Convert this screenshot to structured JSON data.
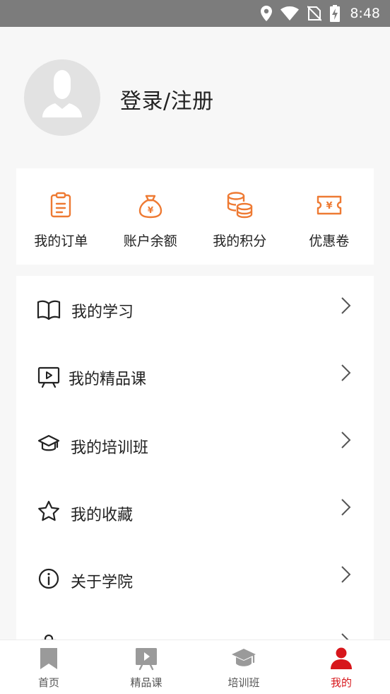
{
  "status_bar": {
    "time": "8:48",
    "icons": [
      "location-icon",
      "wifi-icon",
      "no-sim-icon",
      "battery-charging-icon"
    ]
  },
  "profile": {
    "avatar_icon": "user-silhouette-icon",
    "login_text": "登录/注册"
  },
  "quick_actions": [
    {
      "label": "我的订单",
      "icon": "clipboard-icon"
    },
    {
      "label": "账户余额",
      "icon": "money-bag-icon"
    },
    {
      "label": "我的积分",
      "icon": "coins-stack-icon"
    },
    {
      "label": "优惠卷",
      "icon": "coupon-ticket-icon"
    }
  ],
  "menu": [
    {
      "label": "我的学习",
      "icon": "open-book-icon"
    },
    {
      "label": "我的精品课",
      "icon": "video-board-icon"
    },
    {
      "label": "我的培训班",
      "icon": "graduation-cap-icon"
    },
    {
      "label": "我的收藏",
      "icon": "star-icon"
    },
    {
      "label": "关于学院",
      "icon": "info-icon"
    }
  ],
  "tabs": [
    {
      "label": "首页",
      "icon": "bookmark-icon",
      "active": false
    },
    {
      "label": "精品课",
      "icon": "video-play-icon",
      "active": false
    },
    {
      "label": "培训班",
      "icon": "graduation-cap-icon",
      "active": false
    },
    {
      "label": "我的",
      "icon": "person-icon",
      "active": true
    }
  ],
  "colors": {
    "accent_orange": "#ee7a33",
    "active_red": "#d7161b",
    "inactive_gray": "#9a9a9a",
    "status_bar": "#7c7c7c"
  }
}
